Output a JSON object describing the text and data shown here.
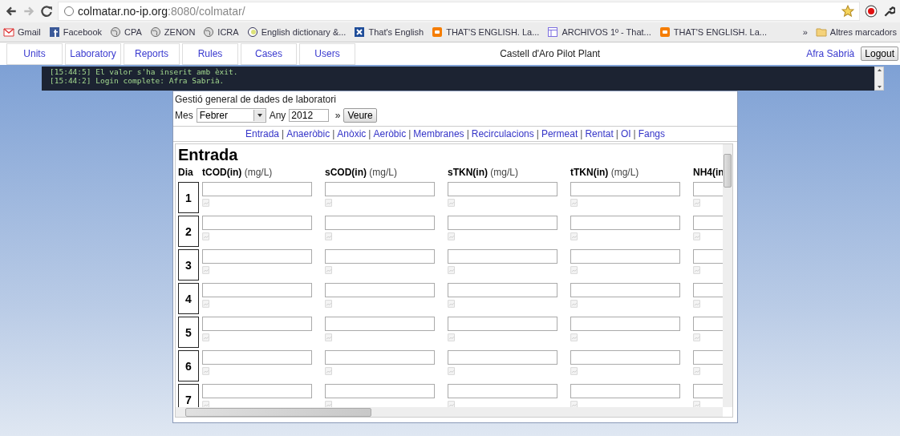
{
  "browser": {
    "url_host": "colmatar.no-ip.org",
    "url_rest": ":8080/colmatar/",
    "bookmarks": [
      {
        "kind": "mail",
        "label": "Gmail"
      },
      {
        "kind": "social",
        "label": "Facebook"
      },
      {
        "kind": "globe",
        "label": "CPA"
      },
      {
        "kind": "globe",
        "label": "ZENON"
      },
      {
        "kind": "globe",
        "label": "ICRA"
      },
      {
        "kind": "dictionary",
        "label": "English dictionary &..."
      },
      {
        "kind": "cross",
        "label": "That's English"
      },
      {
        "kind": "blog",
        "label": "THAT'S ENGLISH. La..."
      },
      {
        "kind": "page",
        "label": "ARCHIVOS 1º - That..."
      },
      {
        "kind": "blog",
        "label": "THAT'S ENGLISH. La..."
      }
    ],
    "overflow": "»",
    "other_bookmarks": "Altres marcadors"
  },
  "nav": {
    "items": [
      {
        "label": "Units"
      },
      {
        "label": "Laboratory"
      },
      {
        "label": "Reports"
      },
      {
        "label": "Rules"
      },
      {
        "label": "Cases"
      },
      {
        "label": "Users"
      }
    ],
    "title": "Castell d'Aro Pilot Plant",
    "user": "Afra Sabrià",
    "logout": "Logout"
  },
  "log": [
    "[15:44:5] El valor s'ha inserit amb èxit.",
    "[15:44:2] Login complete: Afra Sabrià."
  ],
  "panel": {
    "title": "Gestió general de dades de laboratori",
    "month_label": "Mes",
    "month": "Febrer",
    "year_label": "Any",
    "year": "2012",
    "arrow": "»",
    "button": "Veure",
    "separator": "|",
    "sections": [
      "Entrada",
      "Anaeròbic",
      "Anòxic",
      "Aeròbic",
      "Membranes",
      "Recirculacions",
      "Permeat",
      "Rentat",
      "OI",
      "Fangs"
    ],
    "heading": "Entrada",
    "day_label": "Dia",
    "columns": [
      {
        "name": "tCOD(in)",
        "unit": "(mg/L)"
      },
      {
        "name": "sCOD(in)",
        "unit": "(mg/L)"
      },
      {
        "name": "sTKN(in)",
        "unit": "(mg/L)"
      },
      {
        "name": "tTKN(in)",
        "unit": "(mg/L)"
      },
      {
        "name": "NH4(in"
      }
    ],
    "days": [
      "1",
      "2",
      "3",
      "4",
      "5",
      "6",
      "7"
    ]
  }
}
